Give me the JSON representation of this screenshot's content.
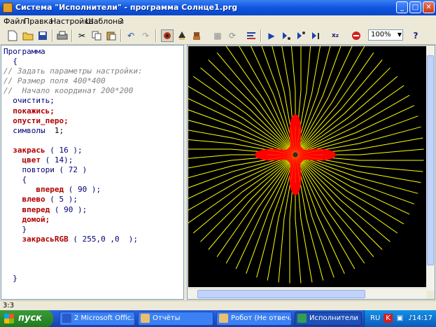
{
  "window": {
    "title": "Система \"Исполнители\" - программа Солнце1.prg"
  },
  "menu": [
    "Файл",
    "Правка",
    "Настройка",
    "Шаблоны",
    "?"
  ],
  "toolbar": {
    "zoom_value": "100%"
  },
  "code_lines": [
    [
      {
        "t": "Программа",
        "c": "cmd"
      }
    ],
    [
      {
        "t": "  {",
        "c": "cmd"
      }
    ],
    [
      {
        "t": "// Задать параметры настройки:",
        "c": "cm"
      }
    ],
    [
      {
        "t": "// Размер поля 400*400",
        "c": "cm"
      }
    ],
    [
      {
        "t": "//  Начало координат 200*200",
        "c": "cm"
      }
    ],
    [
      {
        "t": "  очистить;",
        "c": "cmd"
      }
    ],
    [
      {
        "t": "  покажись;",
        "c": "kw"
      }
    ],
    [
      {
        "t": "  опусти_перо;",
        "c": "kw"
      }
    ],
    [
      {
        "t": "  символы",
        "c": "cmd"
      },
      {
        "t": "  1;",
        "c": "num"
      }
    ],
    [
      {
        "t": "",
        "c": "num"
      }
    ],
    [
      {
        "t": "  закрась",
        "c": "kw"
      },
      {
        "t": " ( 16 );",
        "c": "cmd"
      }
    ],
    [
      {
        "t": "    цвет",
        "c": "kw"
      },
      {
        "t": " ( 14);",
        "c": "cmd"
      }
    ],
    [
      {
        "t": "    повтори ( 72 )",
        "c": "cmd"
      }
    ],
    [
      {
        "t": "    {",
        "c": "cmd"
      }
    ],
    [
      {
        "t": "       вперед",
        "c": "kw"
      },
      {
        "t": " ( 90 );",
        "c": "cmd"
      }
    ],
    [
      {
        "t": "    влево",
        "c": "kw"
      },
      {
        "t": " ( 5 );",
        "c": "cmd"
      }
    ],
    [
      {
        "t": "    вперед",
        "c": "kw"
      },
      {
        "t": " ( 90 );",
        "c": "cmd"
      }
    ],
    [
      {
        "t": "    домой;",
        "c": "kw"
      }
    ],
    [
      {
        "t": "    }",
        "c": "cmd"
      }
    ],
    [
      {
        "t": "    закрасьRGB",
        "c": "kw"
      },
      {
        "t": " ( 255,0 ,0  );",
        "c": "cmd"
      }
    ],
    [
      {
        "t": "",
        "c": "num"
      }
    ],
    [
      {
        "t": "",
        "c": "num"
      }
    ],
    [
      {
        "t": "",
        "c": "num"
      }
    ],
    [
      {
        "t": "  }",
        "c": "cmd"
      }
    ]
  ],
  "canvas": {
    "ray_count": 72,
    "ray_color": "#ffff00",
    "fill_color": "#ff0000",
    "background": "#000000"
  },
  "statusbar": {
    "position": "3:3"
  },
  "taskbar": {
    "start_label": "пуск",
    "tasks": [
      "2 Microsoft Offic...",
      "Отчёты",
      "Робот (Не отвеч...",
      "Исполнители"
    ],
    "language": "RU",
    "clock": "14:17"
  },
  "colors": {
    "titlebar": "#0f55e0",
    "keyword": "#b00000",
    "command": "#00007a",
    "comment": "#808080"
  }
}
